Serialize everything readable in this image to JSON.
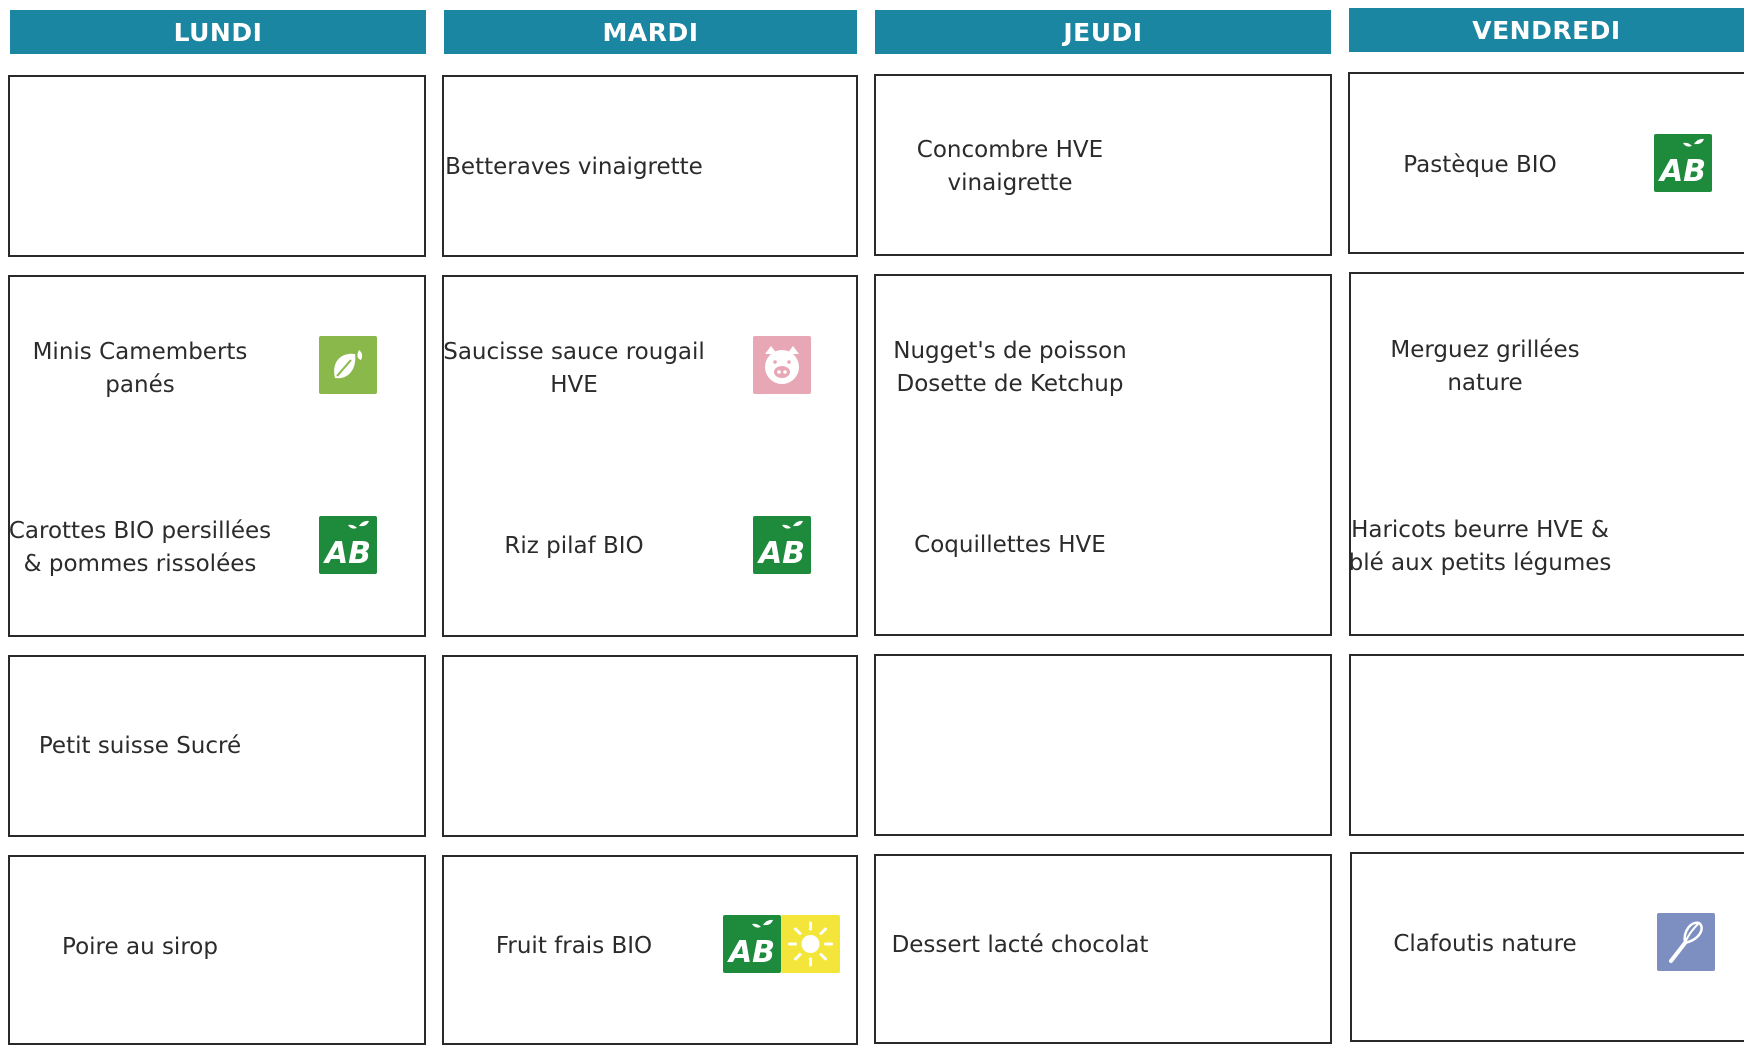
{
  "days": [
    "LUNDI",
    "MARDI",
    "JEUDI",
    "VENDREDI"
  ],
  "menu": {
    "lundi": {
      "entree": "",
      "plat": [
        "Minis Camemberts",
        "panés"
      ],
      "accompagnement": [
        "Carottes BIO persillées",
        "& pommes rissolées"
      ],
      "laitage": "Petit suisse Sucré",
      "dessert": "Poire au sirop"
    },
    "mardi": {
      "entree": "Betteraves vinaigrette",
      "plat": [
        "Saucisse sauce rougail",
        "HVE"
      ],
      "accompagnement": "Riz pilaf BIO",
      "laitage": "",
      "dessert": "Fruit frais BIO"
    },
    "jeudi": {
      "entree": [
        "Concombre HVE",
        "vinaigrette"
      ],
      "plat": [
        "Nugget's de poisson",
        "Dosette de Ketchup"
      ],
      "accompagnement": "Coquillettes HVE",
      "laitage": "",
      "dessert": "Dessert lacté chocolat"
    },
    "vendredi": {
      "entree": "Pastèque BIO",
      "plat": [
        "Merguez grillées",
        "nature"
      ],
      "accompagnement": [
        "Haricots beurre HVE &",
        "blé aux petits légumes"
      ],
      "laitage": "",
      "dessert": "Clafoutis nature"
    }
  },
  "badges": {
    "lundi_plat": "vegetarian-leaf-icon",
    "lundi_accompagnement": "organic-ab-icon",
    "mardi_plat": "pork-icon",
    "mardi_accompagnement": "organic-ab-icon",
    "mardi_dessert": "organic-ab-local-sun-icon",
    "vendredi_entree": "organic-ab-icon",
    "vendredi_dessert": "homemade-whisk-icon"
  },
  "colors": {
    "header": "#1b86a2",
    "organic": "#1e8a3c",
    "vegetarian": "#8ab84a",
    "pork": "#e8a7b5",
    "homemade": "#7c8fc0",
    "local_sun": "#f3e53a"
  }
}
